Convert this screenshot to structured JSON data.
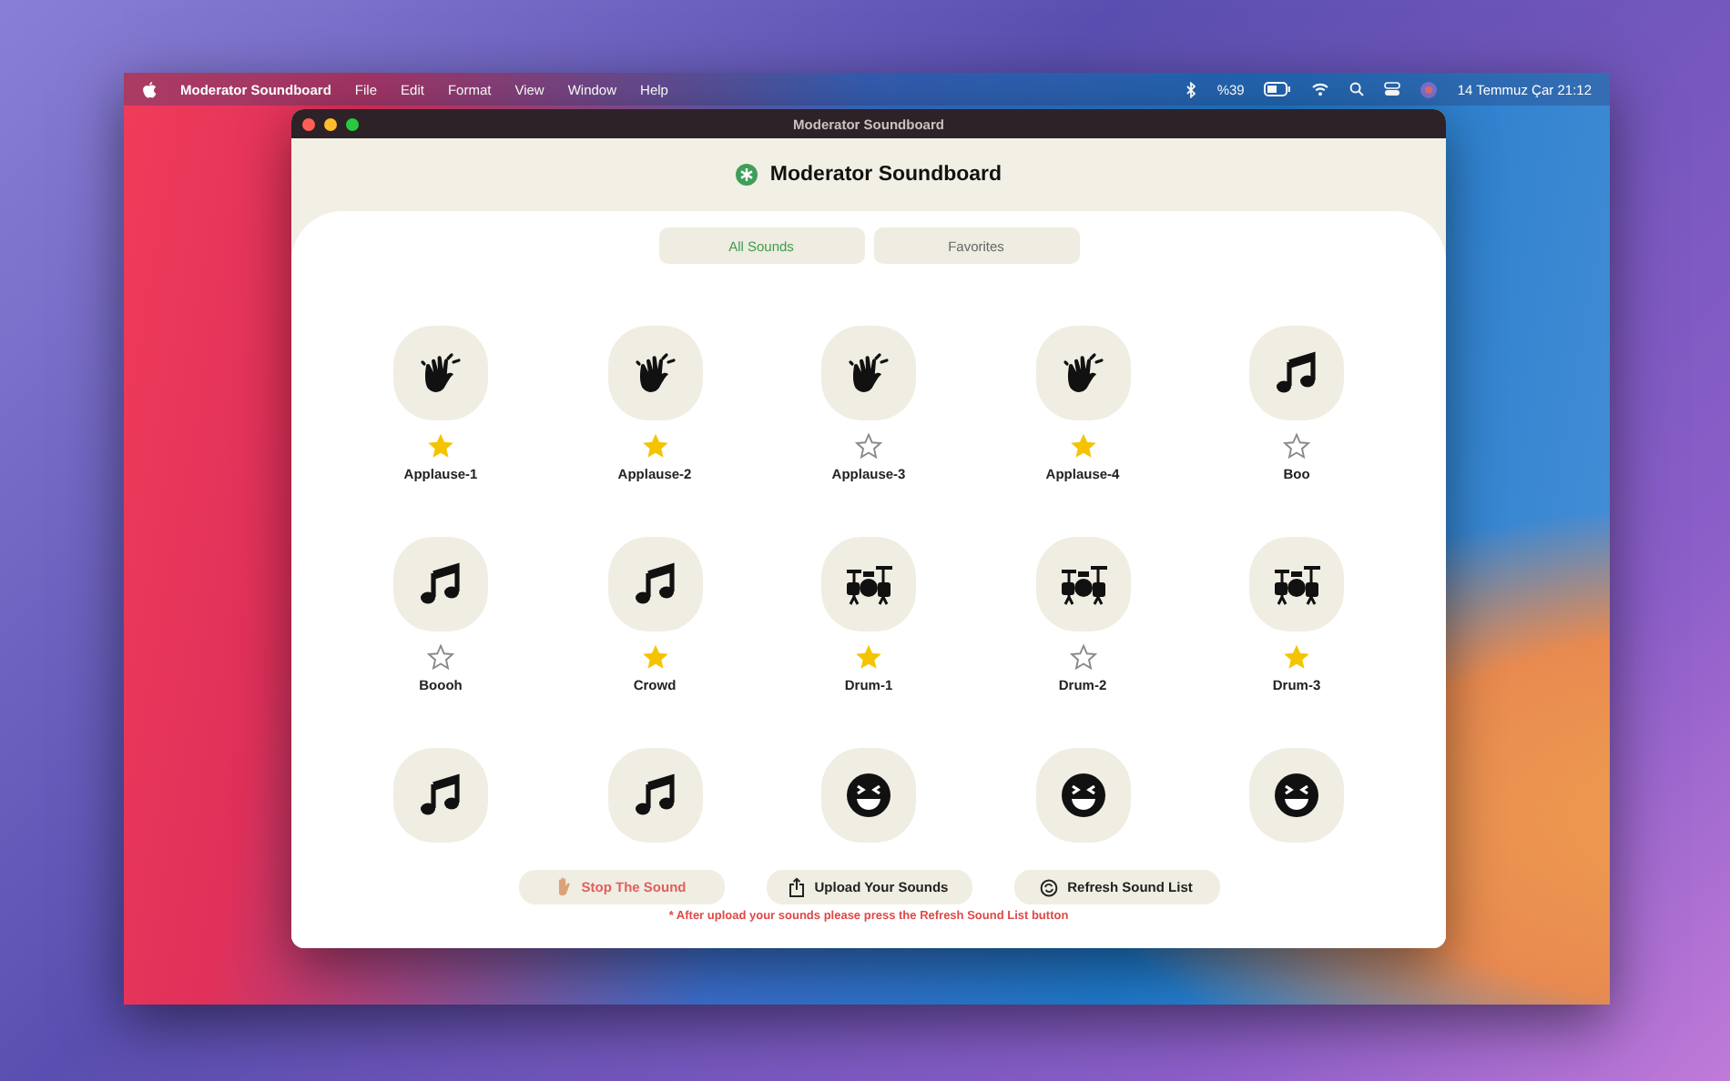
{
  "menubar": {
    "app": "Moderator Soundboard",
    "menus": [
      "File",
      "Edit",
      "Format",
      "View",
      "Window",
      "Help"
    ],
    "battery": "%39",
    "clock": "14 Temmuz Çar  21:12"
  },
  "window": {
    "title": "Moderator Soundboard"
  },
  "header": {
    "title": "Moderator Soundboard"
  },
  "tabs": [
    {
      "label": "All Sounds",
      "selected": true
    },
    {
      "label": "Favorites",
      "selected": false
    }
  ],
  "sounds": [
    {
      "kind": "clap",
      "favorite": true,
      "label": "Applause-1"
    },
    {
      "kind": "clap",
      "favorite": true,
      "label": "Applause-2"
    },
    {
      "kind": "clap",
      "favorite": false,
      "label": "Applause-3"
    },
    {
      "kind": "clap",
      "favorite": true,
      "label": "Applause-4"
    },
    {
      "kind": "note",
      "favorite": false,
      "label": "Boo"
    },
    {
      "kind": "note",
      "favorite": false,
      "label": "Boooh"
    },
    {
      "kind": "note",
      "favorite": true,
      "label": "Crowd"
    },
    {
      "kind": "drums",
      "favorite": true,
      "label": "Drum-1"
    },
    {
      "kind": "drums",
      "favorite": false,
      "label": "Drum-2"
    },
    {
      "kind": "drums",
      "favorite": true,
      "label": "Drum-3"
    },
    {
      "kind": "note"
    },
    {
      "kind": "note"
    },
    {
      "kind": "laugh"
    },
    {
      "kind": "laugh"
    },
    {
      "kind": "laugh"
    }
  ],
  "buttons": [
    {
      "kind": "stop",
      "label": "Stop The Sound"
    },
    {
      "kind": "upload",
      "label": "Upload Your Sounds"
    },
    {
      "kind": "refresh",
      "label": "Refresh Sound List"
    }
  ],
  "note": "* After upload your sounds please press the Refresh Sound List button"
}
